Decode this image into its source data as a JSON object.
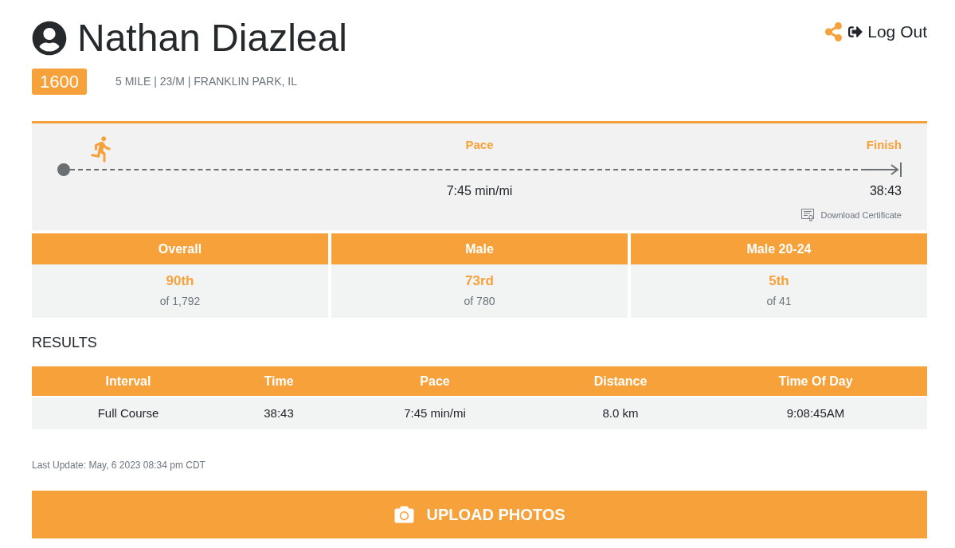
{
  "header": {
    "name": "Nathan Diazleal",
    "bib": "1600",
    "info": "5 MILE | 23/M | FRANKLIN PARK, IL",
    "logout": "Log Out"
  },
  "progress": {
    "level": 0.04,
    "marker_label": "Pace",
    "marker_value": "7:45 min/mi",
    "finish_label": "Finish",
    "finish_value": "38:43",
    "certificate_link": "Download Certificate"
  },
  "rankings": [
    {
      "label": "Overall",
      "place": "90th",
      "total": "of 1,792"
    },
    {
      "label": "Male",
      "place": "73rd",
      "total": "of 780"
    },
    {
      "label": "Male 20-24",
      "place": "5th",
      "total": "of 41"
    }
  ],
  "results": {
    "title": "RESULTS",
    "columns": [
      "Interval",
      "Time",
      "Pace",
      "Distance",
      "Time Of Day"
    ],
    "rows": [
      {
        "cells": [
          "Full Course",
          "38:43",
          "7:45 min/mi",
          "8.0 km",
          "9:08:45AM"
        ]
      }
    ]
  },
  "last_update": "Last Update: May, 6 2023 08:34 pm CDT",
  "upload_button": "UPLOAD PHOTOS"
}
